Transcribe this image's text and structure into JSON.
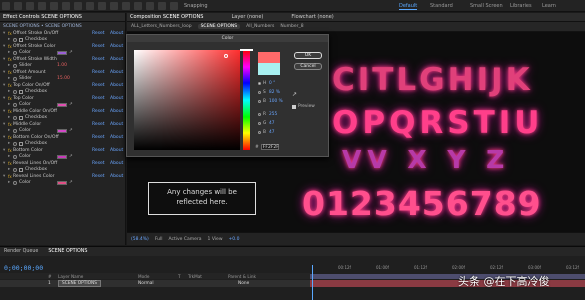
{
  "workspace": {
    "search_label": "Snapping",
    "items": [
      "Default",
      "Standard",
      "Small Screen",
      "Libraries",
      "Learn"
    ],
    "active": "Default"
  },
  "effect_controls": {
    "tab": "Effect Controls SCENE OPTIONS",
    "subtitle": "SCENE OPTIONS • SCENE OPTIONS",
    "rows": [
      {
        "label": "Offset Stroke On/Off",
        "reset": "Reset",
        "about": "About",
        "kind": "fx"
      },
      {
        "label": "Checkbox",
        "kind": "check"
      },
      {
        "label": "Offset Stroke Color",
        "reset": "Reset",
        "about": "About",
        "kind": "fx"
      },
      {
        "label": "Color",
        "kind": "color",
        "color": "#9a5fd6"
      },
      {
        "label": "Offset Stroke Width",
        "reset": "Reset",
        "about": "About",
        "kind": "fx"
      },
      {
        "label": "Slider",
        "value": "1.00",
        "kind": "value"
      },
      {
        "label": "Offset Amount",
        "reset": "Reset",
        "about": "About",
        "kind": "fx"
      },
      {
        "label": "Slider",
        "value": "15.00",
        "kind": "value"
      },
      {
        "label": "Top Color On/Off",
        "reset": "Reset",
        "about": "About",
        "kind": "fx"
      },
      {
        "label": "Checkbox",
        "kind": "check"
      },
      {
        "label": "Top Color",
        "reset": "Reset",
        "about": "About",
        "kind": "fx"
      },
      {
        "label": "Color",
        "kind": "color",
        "color": "#e04fb0"
      },
      {
        "label": "Middle Color On/Off",
        "reset": "Reset",
        "about": "About",
        "kind": "fx"
      },
      {
        "label": "Checkbox",
        "kind": "check"
      },
      {
        "label": "Middle Color",
        "reset": "Reset",
        "about": "About",
        "kind": "fx"
      },
      {
        "label": "Color",
        "kind": "color",
        "color": "#d448c7"
      },
      {
        "label": "Bottom Color On/Off",
        "reset": "Reset",
        "about": "About",
        "kind": "fx"
      },
      {
        "label": "Checkbox",
        "kind": "check"
      },
      {
        "label": "Bottom Color",
        "reset": "Reset",
        "about": "About",
        "kind": "fx"
      },
      {
        "label": "Color",
        "kind": "color",
        "color": "#c63ab8"
      },
      {
        "label": "Reveal Lines On/Off",
        "reset": "Reset",
        "about": "About",
        "kind": "fx"
      },
      {
        "label": "Checkbox",
        "kind": "check"
      },
      {
        "label": "Reveal Lines Color",
        "reset": "Reset",
        "about": "About",
        "kind": "fx"
      },
      {
        "label": "Color",
        "kind": "color",
        "color": "#e04f85"
      }
    ]
  },
  "composition": {
    "tab": "Composition SCENE OPTIONS",
    "layer_tab": "Layer (none)",
    "flowchart_tab": "Flowchart (none)",
    "nav": [
      "ALL_Letters_Numbers_loop",
      "SCENE OPTIONS",
      "All_Numbers",
      "Number_8"
    ],
    "nav_current": "SCENE OPTIONS",
    "notice_line1": "Any changes will be",
    "notice_line2": "reflected here.",
    "footer": {
      "zoom": "(58.4%)",
      "quality": "Full",
      "camera": "Active Camera",
      "view": "1 View",
      "exposure": "+0.0"
    },
    "glyph_rows": [
      {
        "text": "CITLGHIJK",
        "color": "#e0407a"
      },
      {
        "text": "OPQRSTIU",
        "color": "#ff3f8a"
      },
      {
        "text": "VV X Y Z",
        "color": "#b73aa8"
      },
      {
        "text": "0123456789",
        "color": "#ff4f8d"
      }
    ]
  },
  "color_dialog": {
    "title": "Color",
    "ok": "OK",
    "cancel": "Cancel",
    "new_color": "#ff6a6a",
    "old_color": "#a8f0f0",
    "hsb": [
      {
        "k": "H",
        "v": "0 °"
      },
      {
        "k": "S",
        "v": "82 %"
      },
      {
        "k": "B",
        "v": "100 %"
      }
    ],
    "rgb": [
      {
        "k": "R",
        "v": "255"
      },
      {
        "k": "G",
        "v": "47"
      },
      {
        "k": "B",
        "v": "47"
      }
    ],
    "hex_label": "#",
    "hex": "FF2F2F",
    "preview_label": "Preview"
  },
  "timeline": {
    "tabs": [
      "Render Queue",
      "SCENE OPTIONS"
    ],
    "timecode": "0;00;00;00",
    "columns": [
      "#",
      "Layer Name",
      "Mode",
      "T",
      "TrkMat",
      "Parent & Link"
    ],
    "layer": {
      "index": "1",
      "name": "SCENE OPTIONS",
      "mode": "Normal",
      "parent": "None"
    },
    "ruler": [
      "00:12f",
      "01:00f",
      "01:12f",
      "02:00f",
      "02:12f",
      "03:00f",
      "03:12f"
    ]
  },
  "watermark": "头条 @在下高冷俊"
}
